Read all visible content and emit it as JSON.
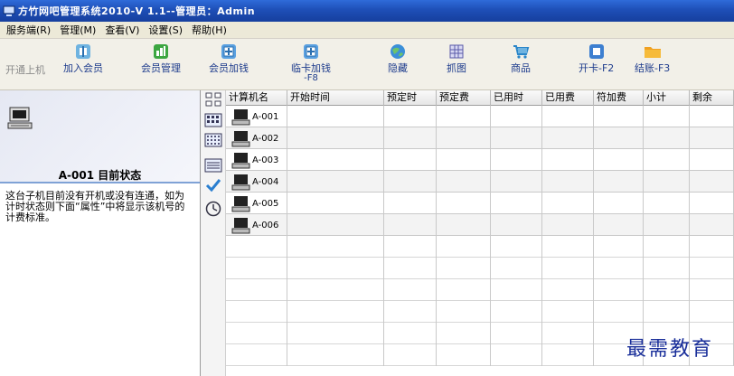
{
  "window": {
    "title": "方竹网吧管理系统2010-V 1.1--管理员：Admin"
  },
  "menu": {
    "items": [
      {
        "label": "服务端(R)"
      },
      {
        "label": "管理(M)"
      },
      {
        "label": "查看(V)"
      },
      {
        "label": "设置(S)"
      },
      {
        "label": "帮助(H)"
      }
    ]
  },
  "toolbar": {
    "buttons": [
      {
        "label": "开通上机",
        "icon": "power-icon",
        "enabled": false
      },
      {
        "label": "加入会员",
        "icon": "add-member-icon",
        "enabled": true
      },
      {
        "label": "会员管理",
        "icon": "member-manage-icon",
        "enabled": true
      },
      {
        "label": "会员加钱",
        "icon": "add-money-icon",
        "enabled": true
      },
      {
        "label": "临卡加钱",
        "label2": "-F8",
        "icon": "temp-card-icon",
        "enabled": true
      },
      {
        "label": "隐藏",
        "icon": "globe-icon",
        "enabled": true
      },
      {
        "label": "抓图",
        "icon": "screenshot-icon",
        "enabled": true
      },
      {
        "label": "商品",
        "icon": "cart-icon",
        "enabled": true
      },
      {
        "label": "开卡-F2",
        "icon": "open-card-icon",
        "enabled": true
      },
      {
        "label": "结账-F3",
        "icon": "folder-icon",
        "enabled": true
      }
    ]
  },
  "left_panel": {
    "status_title": "A-001 目前状态",
    "status_text": "这台子机目前没有开机或没有连通，如为计时状态则下面“属性”中将显示该机号的计费标准。"
  },
  "grid": {
    "columns": [
      "计算机名",
      "开始时间",
      "预定时",
      "预定费",
      "已用时",
      "已用费",
      "符加费",
      "小计",
      "剩余"
    ],
    "rows": [
      {
        "name": "A-001"
      },
      {
        "name": "A-002"
      },
      {
        "name": "A-003"
      },
      {
        "name": "A-004"
      },
      {
        "name": "A-005"
      },
      {
        "name": "A-006"
      }
    ]
  },
  "watermark": {
    "text": "最需教育"
  },
  "colors": {
    "titlebar": "#1e4fb7",
    "toolbar_text": "#1d3b8c",
    "accent": "#7fa2d6"
  }
}
